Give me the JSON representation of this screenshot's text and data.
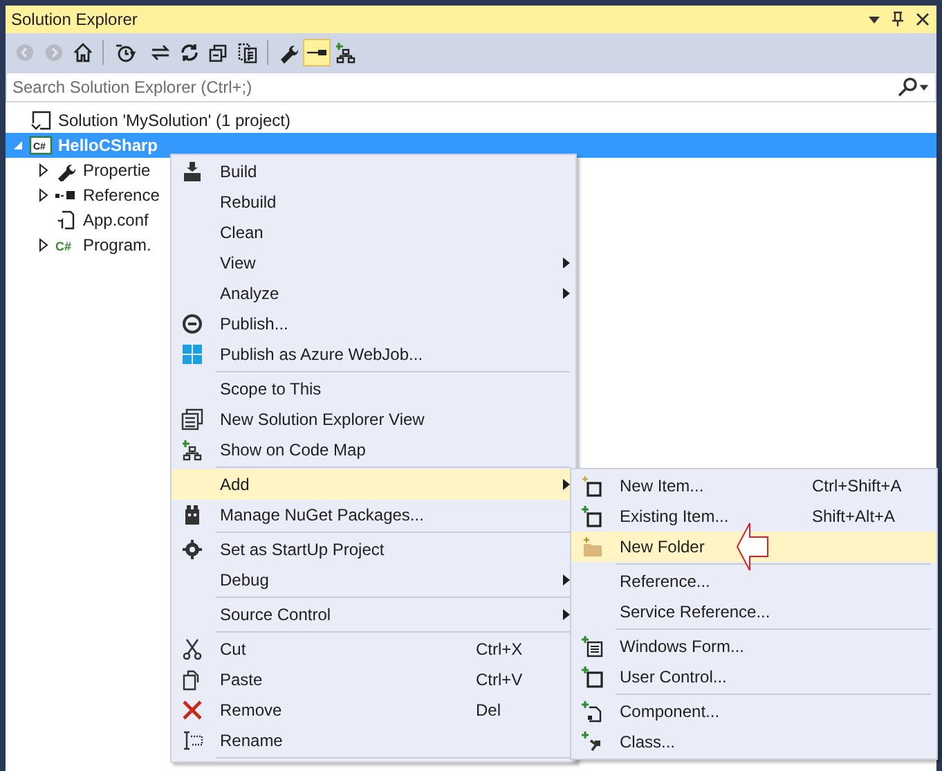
{
  "window": {
    "title": "Solution Explorer"
  },
  "toolbar_buttons": [
    {
      "disabled": true,
      "selected": false
    },
    {
      "disabled": true,
      "selected": false
    },
    {
      "disabled": false,
      "selected": false
    },
    {
      "disabled": false,
      "selected": false
    },
    {
      "disabled": false,
      "selected": false
    },
    {
      "disabled": false,
      "selected": false
    },
    {
      "disabled": false,
      "selected": false
    },
    {
      "disabled": false,
      "selected": false
    },
    {
      "disabled": false,
      "selected": false
    },
    {
      "disabled": false,
      "selected": true
    },
    {
      "disabled": false,
      "selected": false
    }
  ],
  "search": {
    "placeholder": "Search Solution Explorer (Ctrl+;)"
  },
  "tree": [
    {
      "label": "Solution 'MySolution' (1 project)",
      "selected": false,
      "children": [
        {
          "label": "HelloCSharp",
          "icon_label": "C#",
          "expanded": true,
          "selected": true,
          "children": [
            {
              "label": "Propertie",
              "expanded": false,
              "selected": false
            },
            {
              "label": "Reference",
              "expanded": false,
              "selected": false
            },
            {
              "label": "App.conf",
              "selected": false
            },
            {
              "label": "Program.",
              "icon_label": "C#",
              "expanded": false,
              "selected": false
            }
          ]
        }
      ]
    }
  ],
  "context_menu": [
    {
      "kind": "item",
      "label": "Build",
      "submenu": false,
      "selected": false
    },
    {
      "kind": "item",
      "label": "Rebuild",
      "submenu": false,
      "selected": false
    },
    {
      "kind": "item",
      "label": "Clean",
      "submenu": false,
      "selected": false
    },
    {
      "kind": "item",
      "label": "View",
      "submenu": true,
      "selected": false
    },
    {
      "kind": "item",
      "label": "Analyze",
      "submenu": true,
      "selected": false
    },
    {
      "kind": "item",
      "label": "Publish...",
      "submenu": false,
      "selected": false
    },
    {
      "kind": "item",
      "label": "Publish as Azure WebJob...",
      "submenu": false,
      "selected": false
    },
    {
      "kind": "separator"
    },
    {
      "kind": "item",
      "label": "Scope to This",
      "submenu": false,
      "selected": false
    },
    {
      "kind": "item",
      "label": "New Solution Explorer View",
      "submenu": false,
      "selected": false
    },
    {
      "kind": "item",
      "label": "Show on Code Map",
      "submenu": false,
      "selected": false
    },
    {
      "kind": "separator"
    },
    {
      "kind": "item",
      "label": "Add",
      "submenu": true,
      "selected": true
    },
    {
      "kind": "item",
      "label": "Manage NuGet Packages...",
      "submenu": false,
      "selected": false
    },
    {
      "kind": "separator"
    },
    {
      "kind": "item",
      "label": "Set as StartUp Project",
      "submenu": false,
      "selected": false
    },
    {
      "kind": "item",
      "label": "Debug",
      "submenu": true,
      "selected": false
    },
    {
      "kind": "separator"
    },
    {
      "kind": "item",
      "label": "Source Control",
      "submenu": true,
      "selected": false
    },
    {
      "kind": "separator"
    },
    {
      "kind": "item",
      "label": "Cut",
      "shortcut": "Ctrl+X",
      "submenu": false,
      "selected": false
    },
    {
      "kind": "item",
      "label": "Paste",
      "shortcut": "Ctrl+V",
      "submenu": false,
      "selected": false
    },
    {
      "kind": "item",
      "label": "Remove",
      "shortcut": "Del",
      "submenu": false,
      "selected": false
    },
    {
      "kind": "item",
      "label": "Rename",
      "submenu": false,
      "selected": false
    },
    {
      "kind": "separator"
    }
  ],
  "add_submenu": [
    {
      "kind": "item",
      "label": "New Item...",
      "shortcut": "Ctrl+Shift+A",
      "submenu": false,
      "selected": false
    },
    {
      "kind": "item",
      "label": "Existing Item...",
      "shortcut": "Shift+Alt+A",
      "submenu": false,
      "selected": false
    },
    {
      "kind": "item",
      "label": "New Folder",
      "submenu": false,
      "selected": true
    },
    {
      "kind": "separator"
    },
    {
      "kind": "item",
      "label": "Reference...",
      "submenu": false,
      "selected": false
    },
    {
      "kind": "item",
      "label": "Service Reference...",
      "submenu": false,
      "selected": false
    },
    {
      "kind": "separator"
    },
    {
      "kind": "item",
      "label": "Windows Form...",
      "submenu": false,
      "selected": false
    },
    {
      "kind": "item",
      "label": "User Control...",
      "submenu": false,
      "selected": false
    },
    {
      "kind": "separator"
    },
    {
      "kind": "item",
      "label": "Component...",
      "submenu": false,
      "selected": false
    },
    {
      "kind": "item",
      "label": "Class...",
      "submenu": false,
      "selected": false
    }
  ]
}
